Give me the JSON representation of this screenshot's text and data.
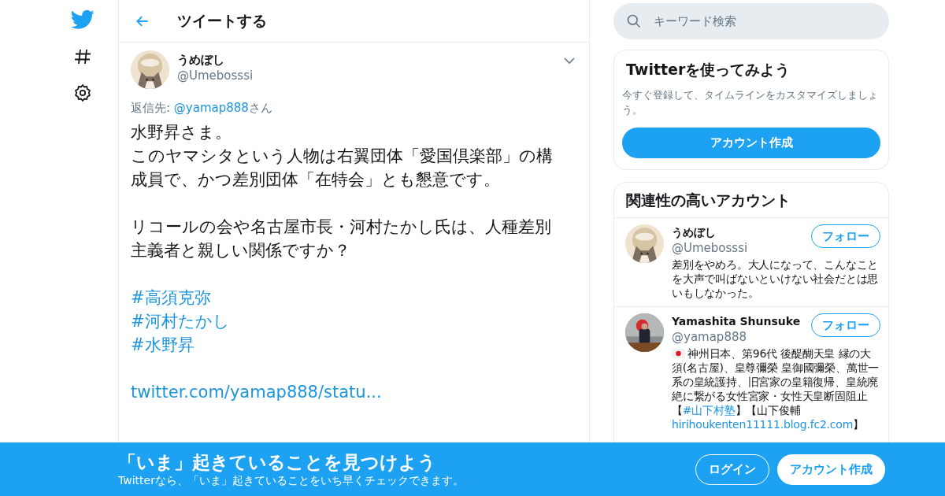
{
  "nav": [
    {
      "kind": "logo"
    },
    {
      "kind": "hashtag"
    },
    {
      "kind": "settings"
    }
  ],
  "header": {
    "title": "ツイートする"
  },
  "tweet": {
    "name": "うめぼし",
    "handle": "@Umebosssi",
    "reply_prefix": "返信先: ",
    "reply_to": "@yamap888",
    "reply_suffix": "さん",
    "body": [
      {
        "lines": [
          [
            {
              "kind": "text",
              "text": "水野昇さま。"
            }
          ],
          [
            {
              "kind": "text",
              "text": "このヤマシタという人物は右翼団体「愛国倶楽部」の構成員で、かつ差別団体「在特会」とも懇意です。"
            }
          ]
        ]
      },
      {
        "lines": [
          [
            {
              "kind": "text",
              "text": "リコールの会や名古屋市長・河村たかし氏は、人種差別主義者と親しい関係ですか？"
            }
          ]
        ]
      },
      {
        "lines": [
          [
            {
              "kind": "hashtag",
              "text": "#高須克弥"
            }
          ],
          [
            {
              "kind": "hashtag",
              "text": "#河村たかし"
            }
          ],
          [
            {
              "kind": "hashtag",
              "text": "#水野昇"
            }
          ]
        ]
      },
      {
        "lines": [
          [
            {
              "kind": "link",
              "text": "twitter.com/yamap888/statu..."
            }
          ]
        ]
      }
    ]
  },
  "search": {
    "placeholder": "キーワード検索"
  },
  "signup_card": {
    "title": "Twitterを使ってみよう",
    "text": "今すぐ登録して、タイムラインをカスタマイズしましょう。",
    "button": "アカウント作成"
  },
  "related": {
    "title": "関連性の高いアカウント",
    "accounts": [
      {
        "name": "うめぼし",
        "handle": "@Umebosssi",
        "button": "フォロー",
        "bio": [
          {
            "kind": "text",
            "text": "差別をやめろ。大人になって、こんなことを大声で叫ばないといけない社会だとは思いもしなかった。"
          }
        ]
      },
      {
        "name": "Yamashita Shunsuke",
        "handle": "@yamap888",
        "button": "フォロー",
        "bio": [
          {
            "kind": "flag"
          },
          {
            "kind": "text",
            "text": "神州日本、第96代 後醍醐天皇 縁の大須(名古屋)、皇尊彌榮 皇御國彌榮、萬世一系の皇統護持、旧宮家の皇籍復帰、皇統廃絶に繋がる女性宮家・女性天皇断固阻止【"
          },
          {
            "kind": "hashtag",
            "text": "#山下村塾"
          },
          {
            "kind": "text",
            "text": "】【山下俊輔 "
          },
          {
            "kind": "link",
            "text": "hirihoukenten11111.blog.fc2.com"
          },
          {
            "kind": "text",
            "text": "】"
          }
        ]
      }
    ]
  },
  "banner": {
    "title": "「いま」起きていることを見つけよう",
    "text": "Twitterなら、「いま」起きていることをいち早くチェックできます。",
    "login": "ログイン",
    "signup": "アカウント作成"
  }
}
